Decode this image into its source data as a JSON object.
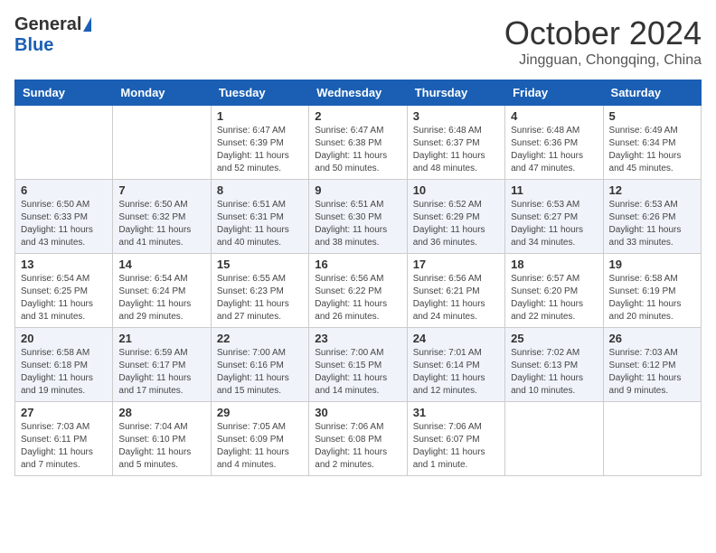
{
  "header": {
    "logo_general": "General",
    "logo_blue": "Blue",
    "month_title": "October 2024",
    "location": "Jingguan, Chongqing, China"
  },
  "days_of_week": [
    "Sunday",
    "Monday",
    "Tuesday",
    "Wednesday",
    "Thursday",
    "Friday",
    "Saturday"
  ],
  "weeks": [
    [
      {
        "day": "",
        "info": ""
      },
      {
        "day": "",
        "info": ""
      },
      {
        "day": "1",
        "info": "Sunrise: 6:47 AM\nSunset: 6:39 PM\nDaylight: 11 hours and 52 minutes."
      },
      {
        "day": "2",
        "info": "Sunrise: 6:47 AM\nSunset: 6:38 PM\nDaylight: 11 hours and 50 minutes."
      },
      {
        "day": "3",
        "info": "Sunrise: 6:48 AM\nSunset: 6:37 PM\nDaylight: 11 hours and 48 minutes."
      },
      {
        "day": "4",
        "info": "Sunrise: 6:48 AM\nSunset: 6:36 PM\nDaylight: 11 hours and 47 minutes."
      },
      {
        "day": "5",
        "info": "Sunrise: 6:49 AM\nSunset: 6:34 PM\nDaylight: 11 hours and 45 minutes."
      }
    ],
    [
      {
        "day": "6",
        "info": "Sunrise: 6:50 AM\nSunset: 6:33 PM\nDaylight: 11 hours and 43 minutes."
      },
      {
        "day": "7",
        "info": "Sunrise: 6:50 AM\nSunset: 6:32 PM\nDaylight: 11 hours and 41 minutes."
      },
      {
        "day": "8",
        "info": "Sunrise: 6:51 AM\nSunset: 6:31 PM\nDaylight: 11 hours and 40 minutes."
      },
      {
        "day": "9",
        "info": "Sunrise: 6:51 AM\nSunset: 6:30 PM\nDaylight: 11 hours and 38 minutes."
      },
      {
        "day": "10",
        "info": "Sunrise: 6:52 AM\nSunset: 6:29 PM\nDaylight: 11 hours and 36 minutes."
      },
      {
        "day": "11",
        "info": "Sunrise: 6:53 AM\nSunset: 6:27 PM\nDaylight: 11 hours and 34 minutes."
      },
      {
        "day": "12",
        "info": "Sunrise: 6:53 AM\nSunset: 6:26 PM\nDaylight: 11 hours and 33 minutes."
      }
    ],
    [
      {
        "day": "13",
        "info": "Sunrise: 6:54 AM\nSunset: 6:25 PM\nDaylight: 11 hours and 31 minutes."
      },
      {
        "day": "14",
        "info": "Sunrise: 6:54 AM\nSunset: 6:24 PM\nDaylight: 11 hours and 29 minutes."
      },
      {
        "day": "15",
        "info": "Sunrise: 6:55 AM\nSunset: 6:23 PM\nDaylight: 11 hours and 27 minutes."
      },
      {
        "day": "16",
        "info": "Sunrise: 6:56 AM\nSunset: 6:22 PM\nDaylight: 11 hours and 26 minutes."
      },
      {
        "day": "17",
        "info": "Sunrise: 6:56 AM\nSunset: 6:21 PM\nDaylight: 11 hours and 24 minutes."
      },
      {
        "day": "18",
        "info": "Sunrise: 6:57 AM\nSunset: 6:20 PM\nDaylight: 11 hours and 22 minutes."
      },
      {
        "day": "19",
        "info": "Sunrise: 6:58 AM\nSunset: 6:19 PM\nDaylight: 11 hours and 20 minutes."
      }
    ],
    [
      {
        "day": "20",
        "info": "Sunrise: 6:58 AM\nSunset: 6:18 PM\nDaylight: 11 hours and 19 minutes."
      },
      {
        "day": "21",
        "info": "Sunrise: 6:59 AM\nSunset: 6:17 PM\nDaylight: 11 hours and 17 minutes."
      },
      {
        "day": "22",
        "info": "Sunrise: 7:00 AM\nSunset: 6:16 PM\nDaylight: 11 hours and 15 minutes."
      },
      {
        "day": "23",
        "info": "Sunrise: 7:00 AM\nSunset: 6:15 PM\nDaylight: 11 hours and 14 minutes."
      },
      {
        "day": "24",
        "info": "Sunrise: 7:01 AM\nSunset: 6:14 PM\nDaylight: 11 hours and 12 minutes."
      },
      {
        "day": "25",
        "info": "Sunrise: 7:02 AM\nSunset: 6:13 PM\nDaylight: 11 hours and 10 minutes."
      },
      {
        "day": "26",
        "info": "Sunrise: 7:03 AM\nSunset: 6:12 PM\nDaylight: 11 hours and 9 minutes."
      }
    ],
    [
      {
        "day": "27",
        "info": "Sunrise: 7:03 AM\nSunset: 6:11 PM\nDaylight: 11 hours and 7 minutes."
      },
      {
        "day": "28",
        "info": "Sunrise: 7:04 AM\nSunset: 6:10 PM\nDaylight: 11 hours and 5 minutes."
      },
      {
        "day": "29",
        "info": "Sunrise: 7:05 AM\nSunset: 6:09 PM\nDaylight: 11 hours and 4 minutes."
      },
      {
        "day": "30",
        "info": "Sunrise: 7:06 AM\nSunset: 6:08 PM\nDaylight: 11 hours and 2 minutes."
      },
      {
        "day": "31",
        "info": "Sunrise: 7:06 AM\nSunset: 6:07 PM\nDaylight: 11 hours and 1 minute."
      },
      {
        "day": "",
        "info": ""
      },
      {
        "day": "",
        "info": ""
      }
    ]
  ]
}
